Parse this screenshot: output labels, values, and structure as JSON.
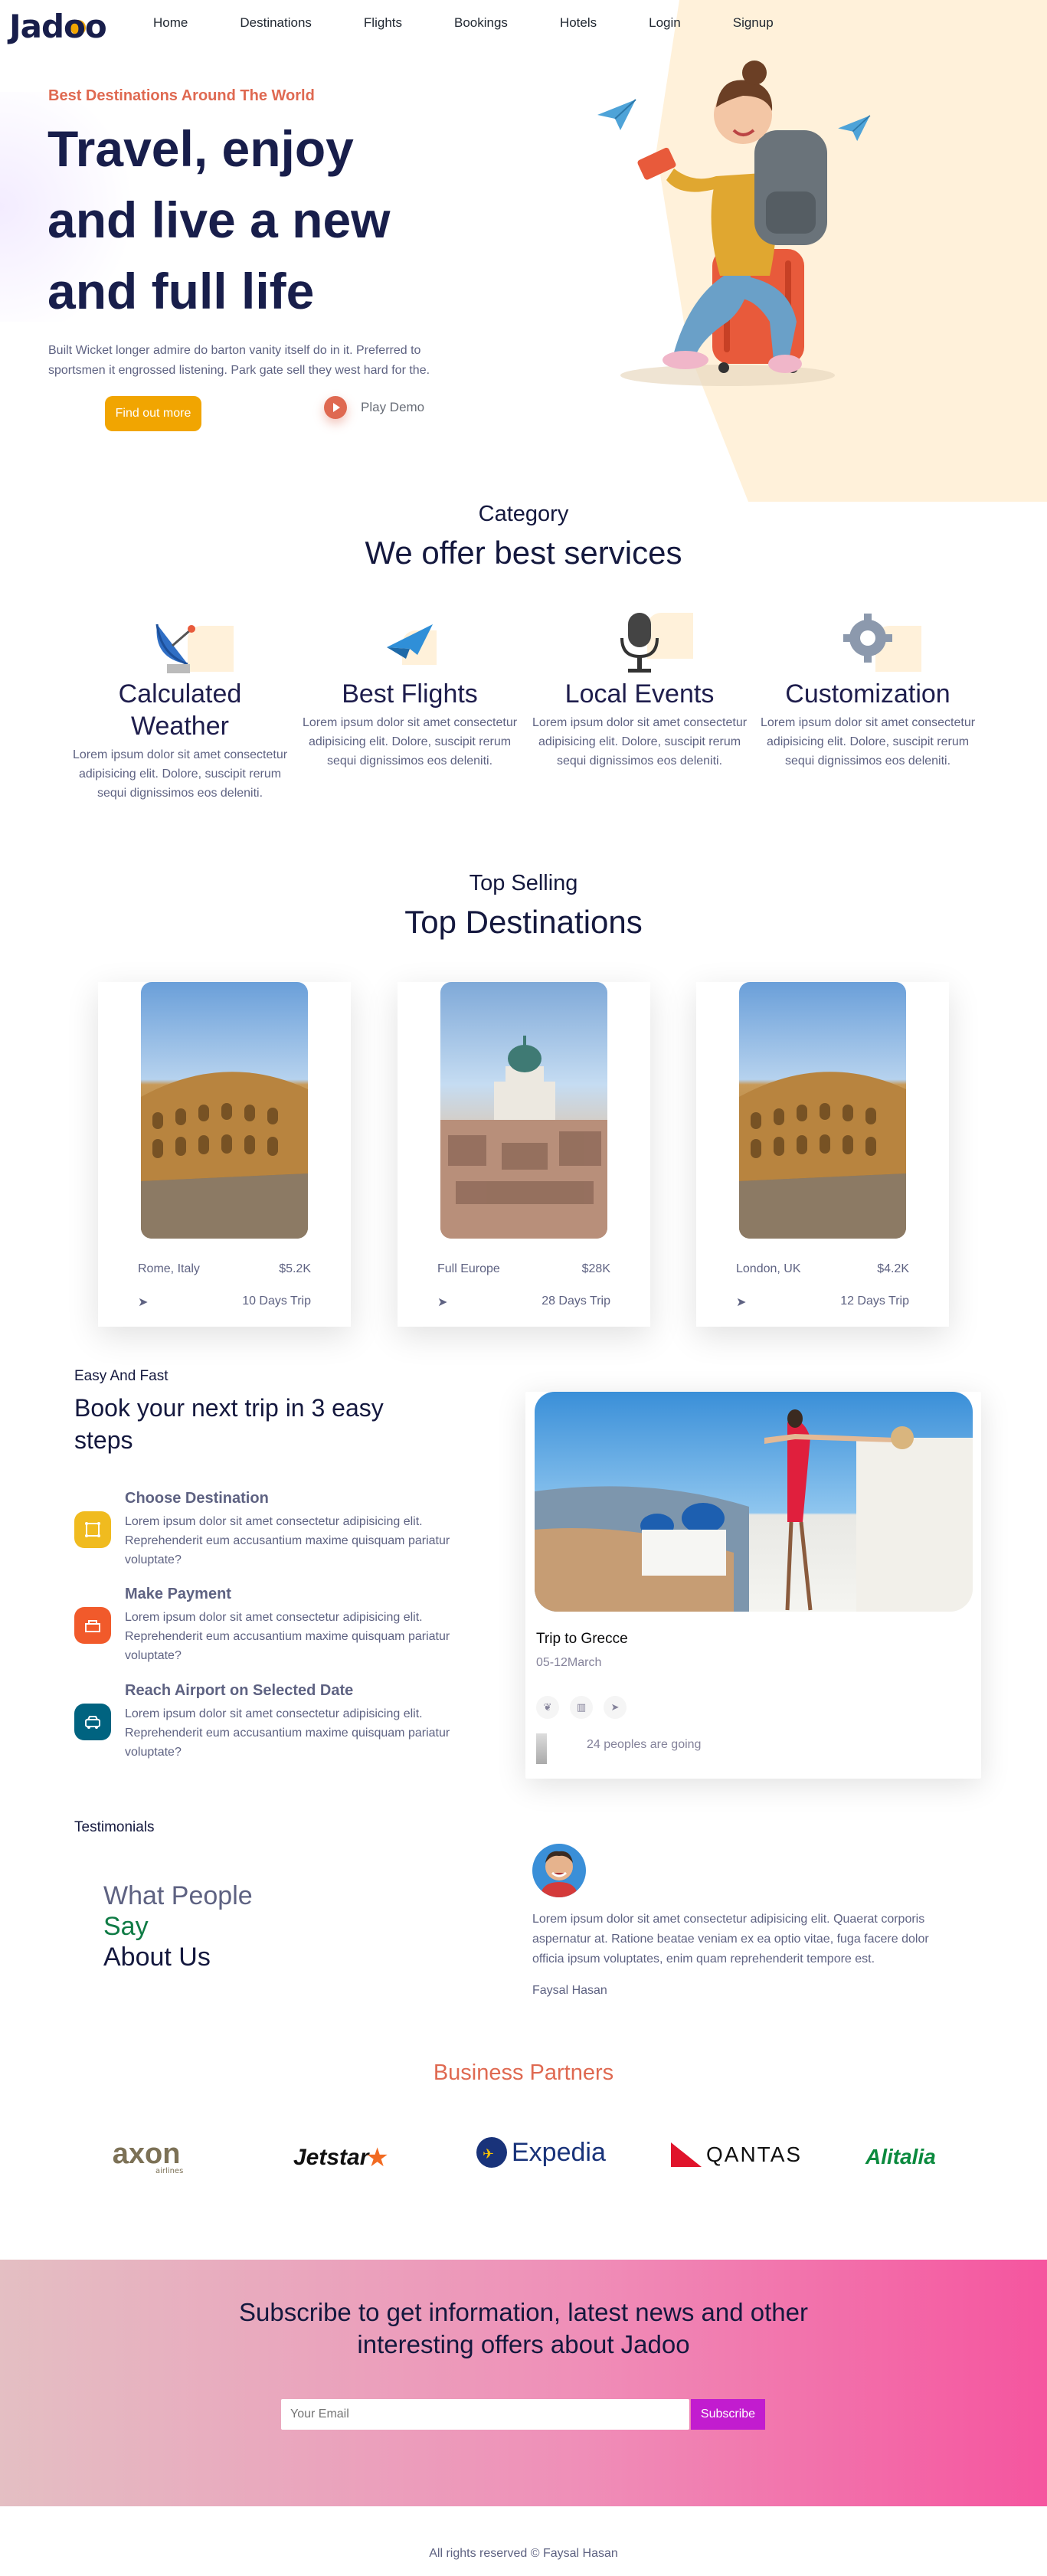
{
  "nav": {
    "logo": "Jadoo",
    "links": [
      "Home",
      "Destinations",
      "Flights",
      "Bookings",
      "Hotels",
      "Login",
      "Signup"
    ]
  },
  "hero": {
    "tag": "Best Destinations Around The World",
    "title": "Travel, enjoy and live a new and full life",
    "desc": "Built Wicket longer admire do barton vanity itself do in it. Preferred to sportsmen it engrossed listening. Park gate sell they west hard for the.",
    "cta": "Find out more",
    "play": "Play Demo"
  },
  "services": {
    "sub": "Category",
    "title": "We offer best services",
    "items": [
      {
        "title": "Calculated Weather",
        "desc": "Lorem ipsum dolor sit amet consectetur adipisicing elit. Dolore, suscipit rerum sequi dignissimos eos deleniti.",
        "icon": "satellite-dish-icon"
      },
      {
        "title": "Best Flights",
        "desc": "Lorem ipsum dolor sit amet consectetur adipisicing elit. Dolore, suscipit rerum sequi dignissimos eos deleniti.",
        "icon": "plane-icon"
      },
      {
        "title": "Local Events",
        "desc": "Lorem ipsum dolor sit amet consectetur adipisicing elit. Dolore, suscipit rerum sequi dignissimos eos deleniti.",
        "icon": "microphone-icon"
      },
      {
        "title": "Customization",
        "desc": "Lorem ipsum dolor sit amet consectetur adipisicing elit. Dolore, suscipit rerum sequi dignissimos eos deleniti.",
        "icon": "gear-icon"
      }
    ]
  },
  "destinations": {
    "sub": "Top Selling",
    "title": "Top Destinations",
    "items": [
      {
        "place": "Rome, Italy",
        "price": "$5.2K",
        "trip": "10 Days Trip"
      },
      {
        "place": "Full Europe",
        "price": "$28K",
        "trip": "28 Days Trip"
      },
      {
        "place": "London, UK",
        "price": "$4.2K",
        "trip": "12 Days Trip"
      }
    ]
  },
  "steps": {
    "sub": "Easy And Fast",
    "title": "Book your next trip in 3 easy steps",
    "items": [
      {
        "title": "Choose Destination",
        "desc": "Lorem ipsum dolor sit amet consectetur adipisicing elit. Reprehenderit eum accusantium maxime quisquam pariatur voluptate?",
        "color": "#f0bb1f"
      },
      {
        "title": "Make Payment",
        "desc": "Lorem ipsum dolor sit amet consectetur adipisicing elit. Reprehenderit eum accusantium maxime quisquam pariatur voluptate?",
        "color": "#f15a2b"
      },
      {
        "title": "Reach Airport on Selected Date",
        "desc": "Lorem ipsum dolor sit amet consectetur adipisicing elit. Reprehenderit eum accusantium maxime quisquam pariatur voluptate?",
        "color": "#006380"
      }
    ],
    "trip": {
      "title": "Trip to Grecce",
      "date": "05-12March",
      "going": "24 peoples are going"
    }
  },
  "testimonials": {
    "sub": "Testimonials",
    "line1": "What People",
    "line2": "Say",
    "line3": "About Us",
    "quote": "Lorem ipsum dolor sit amet consectetur adipisicing elit. Quaerat corporis aspernatur at. Ratione beatae veniam ex ea optio vitae, fuga facere dolor officia ipsum voluptates, enim quam reprehenderit tempore est.",
    "author": "Faysal Hasan"
  },
  "partners": {
    "title": "Business Partners",
    "logos": [
      "axon",
      "airlines",
      "Jetstar",
      "Expedia",
      "QANTAS",
      "Alitalia"
    ]
  },
  "subscribe": {
    "title": "Subscribe to get information, latest news and other interesting offers about Jadoo",
    "placeholder": "Your Email",
    "button": "Subscribe"
  },
  "footer": {
    "text": "All rights reserved © Faysal Hasan"
  },
  "colors": {
    "accent": "#f1a501",
    "coral": "#df6951",
    "navy": "#181e4b",
    "magenta": "#c21ccf"
  }
}
